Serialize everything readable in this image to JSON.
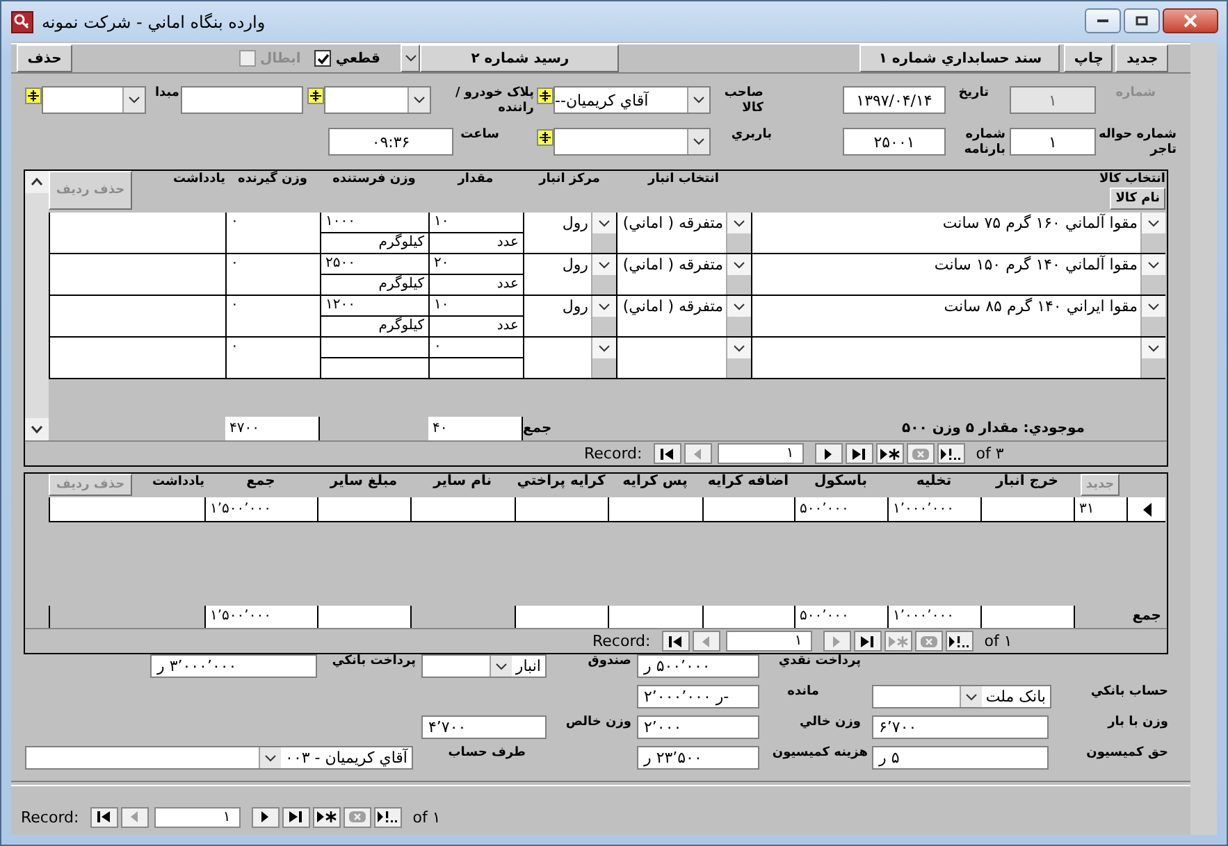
{
  "window": {
    "title": "وارده بنگاه اماني  - شرکت نمونه"
  },
  "toolbar": {
    "new_button": "جديد",
    "print_button": "چاپ",
    "voucher_button": "سند حسابداري شماره ۱",
    "receipt_button": "رسيد شماره ۲",
    "checkboxes": [
      {
        "label": "قطعي",
        "checked": true,
        "disabled": false
      },
      {
        "label": "ابطال",
        "checked": false,
        "disabled": true
      }
    ],
    "delete_button": "حذف"
  },
  "header": {
    "number": {
      "label": "شماره",
      "value": "۱",
      "disabled": true
    },
    "date": {
      "label": "تاريخ",
      "value": "۱۳۹۷/۰۴/۱۴"
    },
    "owner": {
      "label": "صاحب کالا",
      "value": "آقاي کريميان--"
    },
    "plate": {
      "label": "پلاک خودرو / راننده"
    },
    "origin": {
      "label": "مبدا"
    },
    "trader_ref": {
      "label": "شماره حواله تاجر",
      "value": "۱"
    },
    "waybill": {
      "label": "شماره بارنامه",
      "value": "۲۵۰۰۱"
    },
    "carrier": {
      "label": "باربري"
    },
    "time": {
      "label": "ساعت",
      "value": "۰۹:۳۶"
    }
  },
  "items": {
    "columns": [
      "انتخاب کالا",
      "انتخاب انبار",
      "مرکز انبار",
      "مقدار",
      "وزن فرستنده",
      "وزن گيرنده",
      "يادداشت"
    ],
    "product_button": "نام کالا",
    "delete_row_button": {
      "label": "حذف رديف",
      "disabled": true
    },
    "rows": [
      {
        "product": "مقوا آلماني ۱۶۰ گرم ۷۵ سانت",
        "warehouse": "متفرقه ( اماني)",
        "center": "رول",
        "quantity": "۱۰",
        "unit": "عدد",
        "sender_weight": "۱۰۰۰",
        "weight_unit": "کيلوگرم",
        "receiver_weight": "۰"
      },
      {
        "product": "مقوا آلماني ۱۴۰ گرم ۱۵۰ سانت",
        "warehouse": "متفرقه ( اماني)",
        "center": "رول",
        "quantity": "۲۰",
        "unit": "عدد",
        "sender_weight": "۲۵۰۰",
        "weight_unit": "کيلوگرم",
        "receiver_weight": "۰"
      },
      {
        "product": "مقوا ايراني ۱۴۰ گرم ۸۵ سانت",
        "warehouse": "متفرقه ( اماني)",
        "center": "رول",
        "quantity": "۱۰",
        "unit": "عدد",
        "sender_weight": "۱۲۰۰",
        "weight_unit": "کيلوگرم",
        "receiver_weight": "۰"
      },
      {
        "quantity": "۰",
        "receiver_weight": "۰"
      }
    ],
    "totals": {
      "stock": "موجودي: مقدار ۵  وزن ۵۰۰",
      "label": "جمع",
      "quantity": "۴۰",
      "receiver_weight": "۴۷۰۰"
    },
    "navigator": {
      "label": "Record:",
      "current": "۱",
      "count": "of ۳",
      "buttons": [
        {
          "kind": "first",
          "disabled": false
        },
        {
          "kind": "previous",
          "disabled": true
        },
        {
          "kind": "next",
          "disabled": false
        },
        {
          "kind": "last",
          "disabled": false
        },
        {
          "kind": "new",
          "disabled": false
        },
        {
          "kind": "delete",
          "disabled": true
        },
        {
          "kind": "filter",
          "disabled": false
        }
      ]
    }
  },
  "costs": {
    "new_button": {
      "label": "جديد",
      "disabled": true
    },
    "delete_row_button": {
      "label": "حذف رديف",
      "disabled": true
    },
    "columns": [
      "خرج انبار",
      "تخليه",
      "باسکول",
      "اضافه کرايه",
      "پس کرايه",
      "کرايه پراختي",
      "نام ساير",
      "مبلغ ساير",
      "جمع",
      "يادداشت"
    ],
    "rows": [
      {
        "number": "۳۱",
        "unloading": "۱٬۰۰۰٬۰۰۰",
        "scale": "۵۰۰٬۰۰۰",
        "total": "۱٬۵۰۰٬۰۰۰"
      }
    ],
    "totals": {
      "label": "جمع",
      "unloading": "۱٬۰۰۰٬۰۰۰",
      "scale": "۵۰۰٬۰۰۰",
      "total": "۱٬۵۰۰٬۰۰۰"
    },
    "navigator": {
      "label": "Record:",
      "current": "۱",
      "count": "of ۱",
      "buttons": [
        {
          "kind": "first",
          "disabled": false
        },
        {
          "kind": "previous",
          "disabled": true
        },
        {
          "kind": "next",
          "disabled": true
        },
        {
          "kind": "last",
          "disabled": false
        },
        {
          "kind": "new",
          "disabled": true
        },
        {
          "kind": "delete",
          "disabled": true
        },
        {
          "kind": "filter",
          "disabled": false
        }
      ]
    }
  },
  "summary": {
    "cash_payment": {
      "label": "پرداخت نقدي",
      "value": "۵۰۰٬۰۰۰ ر"
    },
    "cash_box": {
      "label": "صندوق",
      "value": "انبار"
    },
    "bank_payment": {
      "label": "پرداخت بانکي",
      "value": "۳٬۰۰۰٬۰۰۰ ر"
    },
    "bank_account": {
      "label": "حساب بانکي",
      "value": "بانک ملت"
    },
    "balance": {
      "label": "مانده",
      "value": "-ر ۲٬۰۰۰٬۰۰۰"
    },
    "loaded_weight": {
      "label": "وزن با بار",
      "value": "۶٬۷۰۰"
    },
    "empty_weight": {
      "label": "وزن خالي",
      "value": "۲٬۰۰۰"
    },
    "net_weight": {
      "label": "وزن خالص",
      "value": "۴٬۷۰۰"
    },
    "commission_rate": {
      "label": "حق کميسيون",
      "value": "۵ ر"
    },
    "commission_cost": {
      "label": "هزينه کميسيون",
      "value": "۲۳٬۵۰۰ ر"
    },
    "counterparty": {
      "label": "طرف حساب",
      "value": "آقاي کريميان - ۰۰۳"
    }
  },
  "navigator": {
    "label": "Record:",
    "current": "۱",
    "count": "of ۱",
    "buttons": [
      {
        "kind": "first",
        "disabled": false
      },
      {
        "kind": "previous",
        "disabled": true
      },
      {
        "kind": "next",
        "disabled": false
      },
      {
        "kind": "last",
        "disabled": false
      },
      {
        "kind": "new",
        "disabled": false
      },
      {
        "kind": "delete",
        "disabled": true
      },
      {
        "kind": "filter",
        "disabled": false
      }
    ]
  }
}
